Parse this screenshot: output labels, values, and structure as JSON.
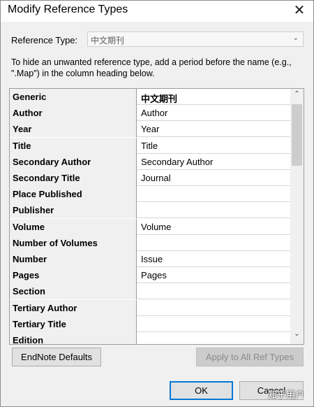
{
  "window": {
    "title": "Modify Reference Types",
    "close_glyph": "✕"
  },
  "reference_type": {
    "label": "Reference Type:",
    "value": "中文期刊",
    "chevron_glyph": "⌄"
  },
  "hint": "To hide an unwanted reference type, add a period before the name (e.g., \".Map\") in the column heading below.",
  "grid": {
    "rows": [
      {
        "field": "Generic",
        "value": "中文期刊"
      },
      {
        "field": "Author",
        "value": "Author"
      },
      {
        "field": "Year",
        "value": "Year"
      },
      {
        "field": "Title",
        "value": "Title"
      },
      {
        "field": "Secondary Author",
        "value": "Secondary Author"
      },
      {
        "field": "Secondary Title",
        "value": "Journal"
      },
      {
        "field": "Place Published",
        "value": ""
      },
      {
        "field": "Publisher",
        "value": ""
      },
      {
        "field": "Volume",
        "value": "Volume"
      },
      {
        "field": "Number of Volumes",
        "value": ""
      },
      {
        "field": "Number",
        "value": "Issue"
      },
      {
        "field": "Pages",
        "value": "Pages"
      },
      {
        "field": "Section",
        "value": ""
      },
      {
        "field": "Tertiary Author",
        "value": ""
      },
      {
        "field": "Tertiary Title",
        "value": ""
      },
      {
        "field": "Edition",
        "value": ""
      }
    ],
    "scroll_up_glyph": "⌃",
    "scroll_down_glyph": "⌄"
  },
  "buttons": {
    "defaults": "EndNote Defaults",
    "apply_all": "Apply to All Ref Types",
    "ok": "OK",
    "cancel": "Cancel"
  },
  "watermark": "知乎用户"
}
